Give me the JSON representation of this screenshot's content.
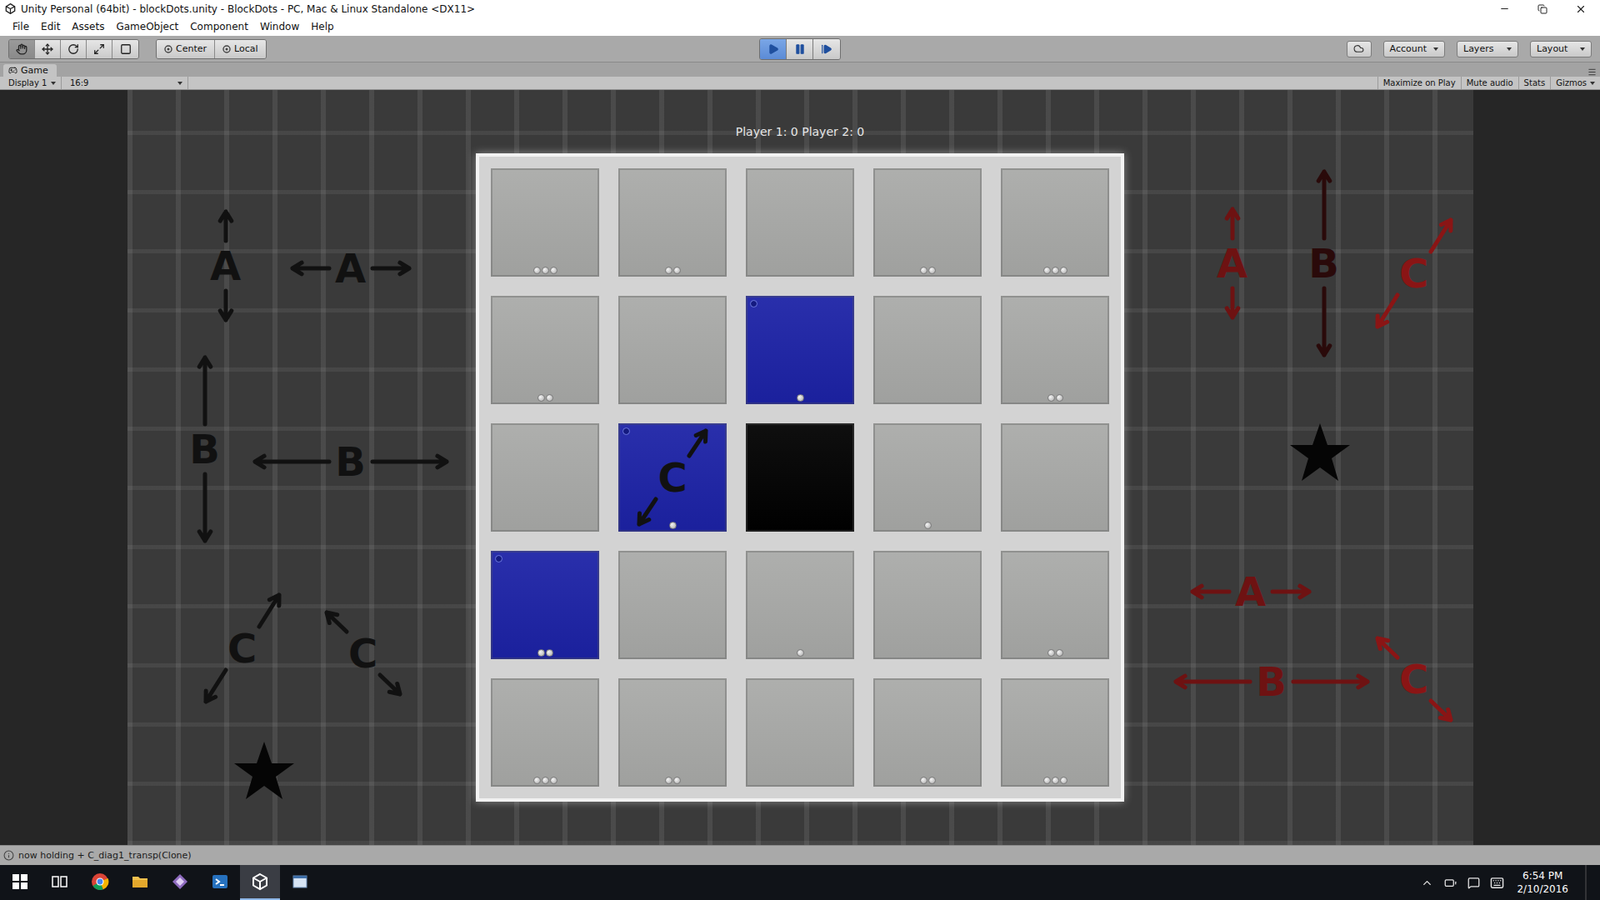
{
  "window": {
    "title": "Unity Personal (64bit) - blockDots.unity - BlockDots - PC, Mac & Linux Standalone <DX11>"
  },
  "menu": [
    "File",
    "Edit",
    "Assets",
    "GameObject",
    "Component",
    "Window",
    "Help"
  ],
  "toolbar": {
    "tools": [
      {
        "kind": "hand",
        "selected": true
      },
      {
        "kind": "move",
        "selected": false
      },
      {
        "kind": "rotate",
        "selected": false
      },
      {
        "kind": "scale",
        "selected": false
      },
      {
        "kind": "rect",
        "selected": false
      }
    ],
    "pivot": [
      {
        "label": "Center"
      },
      {
        "label": "Local"
      }
    ],
    "playback": [
      {
        "kind": "play",
        "selected": true
      },
      {
        "kind": "pause",
        "selected": false
      },
      {
        "kind": "step",
        "selected": false
      }
    ],
    "dropdowns": [
      "Account",
      "Layers",
      "Layout"
    ]
  },
  "game_tab": {
    "label": "Game"
  },
  "game_bar": {
    "display": "Display 1",
    "aspect": "16:9",
    "toggles": [
      {
        "label": "Maximize on Play",
        "on": false
      },
      {
        "label": "Mute audio",
        "on": false
      },
      {
        "label": "Stats",
        "on": false
      },
      {
        "label": "Gizmos",
        "on": false
      }
    ]
  },
  "hud": {
    "score": "Player 1: 0 Player 2: 0"
  },
  "board": {
    "cells": [
      {
        "color": "#a9aaa8",
        "dots": 3,
        "marker": false
      },
      {
        "color": "#a9aaa8",
        "dots": 2,
        "marker": false
      },
      {
        "color": "#a9aaa8",
        "dots": 0,
        "marker": false
      },
      {
        "color": "#a9aaa8",
        "dots": 2,
        "marker": false
      },
      {
        "color": "#a9aaa8",
        "dots": 3,
        "marker": false
      },
      {
        "color": "#a9aaa8",
        "dots": 2,
        "marker": false
      },
      {
        "color": "#a9aaa8",
        "dots": 0,
        "marker": false
      },
      {
        "color": "#1c22a6",
        "dots": 1,
        "marker": true
      },
      {
        "color": "#a9aaa8",
        "dots": 0,
        "marker": false
      },
      {
        "color": "#a9aaa8",
        "dots": 2,
        "marker": false
      },
      {
        "color": "#a9aaa8",
        "dots": 0,
        "marker": false
      },
      {
        "color": "#1c22a6",
        "dots": 1,
        "marker": true,
        "mark": {
          "letter": "C",
          "kind": "diagonal",
          "color": "#111111"
        }
      },
      {
        "color": "#000000",
        "dots": 0,
        "marker": false
      },
      {
        "color": "#a9aaa8",
        "dots": 1,
        "marker": false
      },
      {
        "color": "#a9aaa8",
        "dots": 0,
        "marker": false
      },
      {
        "color": "#1c22a6",
        "dots": 2,
        "marker": true
      },
      {
        "color": "#a9aaa8",
        "dots": 0,
        "marker": false
      },
      {
        "color": "#a9aaa8",
        "dots": 1,
        "marker": false
      },
      {
        "color": "#a9aaa8",
        "dots": 0,
        "marker": false
      },
      {
        "color": "#a9aaa8",
        "dots": 2,
        "marker": false
      },
      {
        "color": "#a9aaa8",
        "dots": 3,
        "marker": false
      },
      {
        "color": "#a9aaa8",
        "dots": 2,
        "marker": false
      },
      {
        "color": "#a9aaa8",
        "dots": 0,
        "marker": false
      },
      {
        "color": "#a9aaa8",
        "dots": 2,
        "marker": false
      },
      {
        "color": "#a9aaa8",
        "dots": 3,
        "marker": false
      }
    ]
  },
  "annotations": [
    {
      "letter": "A",
      "kind": "vertical",
      "color": "#111111"
    },
    {
      "letter": "A",
      "kind": "horizontal",
      "color": "#111111"
    },
    {
      "letter": "B",
      "kind": "vertical",
      "color": "#111111"
    },
    {
      "letter": "B",
      "kind": "horizontal",
      "color": "#111111"
    },
    {
      "letter": "C",
      "kind": "diagonal",
      "color": "#111111"
    },
    {
      "letter": "C",
      "kind": "anti-diagonal",
      "color": "#111111"
    },
    {
      "letter": "A",
      "kind": "vertical",
      "color": "#6e1212"
    },
    {
      "letter": "B",
      "kind": "vertical",
      "color": "#2a0a0a"
    },
    {
      "letter": "C",
      "kind": "diagonal",
      "color": "#8a1515"
    },
    {
      "letter": "A",
      "kind": "horizontal",
      "color": "#6e1212"
    },
    {
      "letter": "B",
      "kind": "horizontal",
      "color": "#6e1212"
    },
    {
      "letter": "C",
      "kind": "anti-diagonal",
      "color": "#8a1515"
    }
  ],
  "status_bar": {
    "message": "now holding + C_diag1_transp(Clone)"
  },
  "taskbar": {
    "apps": [
      {
        "kind": "chrome",
        "selected": false
      },
      {
        "kind": "explorer",
        "selected": false
      },
      {
        "kind": "tool",
        "selected": false
      },
      {
        "kind": "powershell",
        "selected": false
      },
      {
        "kind": "unity",
        "selected": true
      },
      {
        "kind": "window",
        "selected": false
      }
    ],
    "time": "6:54 PM",
    "date": "2/10/2016"
  }
}
